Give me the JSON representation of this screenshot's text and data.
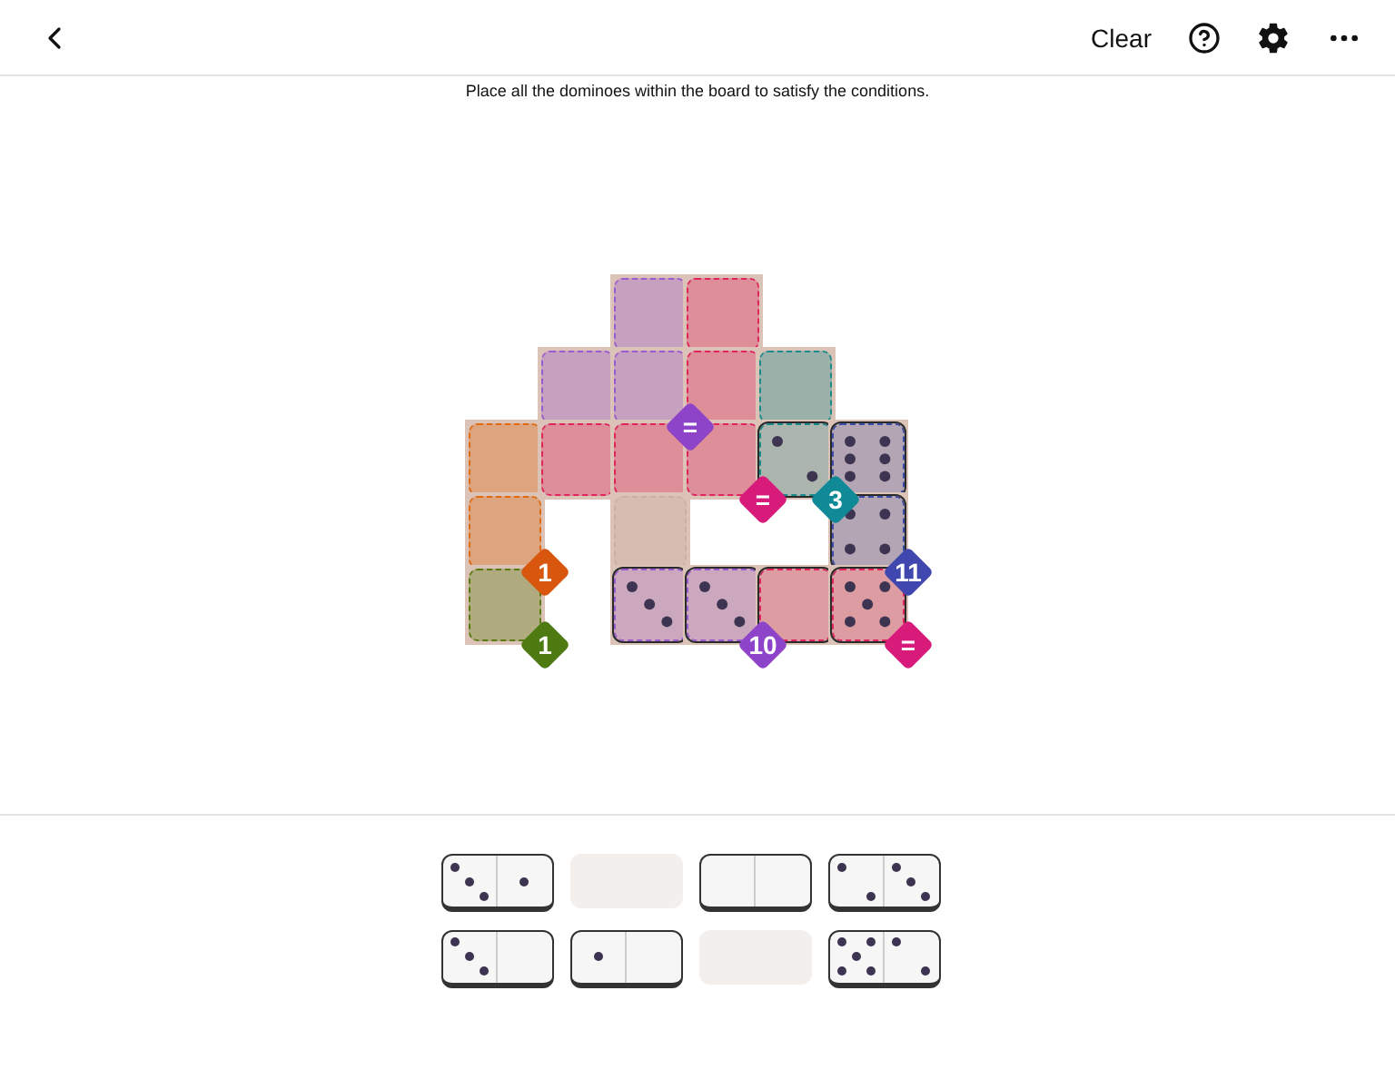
{
  "header": {
    "clear": "Clear"
  },
  "instruction": "Place all the dominoes within the board to satisfy the conditions.",
  "board": {
    "rows": [
      {
        "cells": [
          {
            "kind": "hole"
          },
          {
            "kind": "hole"
          },
          {
            "kind": "cell",
            "color": "#9b59d0"
          },
          {
            "kind": "cell",
            "color": "#e0245e"
          },
          {
            "kind": "hole"
          },
          {
            "kind": "hole"
          }
        ]
      },
      {
        "cells": [
          {
            "kind": "hole"
          },
          {
            "kind": "cell",
            "color": "#9b59d0"
          },
          {
            "kind": "cell",
            "color": "#9b59d0",
            "badge": {
              "label": "=",
              "color": "#8e44c8"
            }
          },
          {
            "kind": "cell",
            "color": "#e0245e"
          },
          {
            "kind": "cell",
            "color": "#1a8a8a"
          },
          {
            "kind": "hole"
          }
        ]
      },
      {
        "cells": [
          {
            "kind": "cell",
            "color": "#e06a10"
          },
          {
            "kind": "cell",
            "color": "#e0245e"
          },
          {
            "kind": "cell",
            "color": "#e0245e"
          },
          {
            "kind": "cell",
            "color": "#e0245e",
            "badge": {
              "label": "=",
              "color": "#d81b7a"
            }
          },
          {
            "kind": "cell",
            "color": "#1a8a8a",
            "face": {
              "kind": "two"
            },
            "badge": {
              "label": "3",
              "color": "#108a96"
            }
          },
          {
            "kind": "cell",
            "color": "#3a4aa8",
            "face": {
              "kind": "six"
            }
          }
        ]
      },
      {
        "cells": [
          {
            "kind": "cell",
            "color": "#e06a10",
            "badge": {
              "label": "1",
              "color": "#d9560e"
            }
          },
          {
            "kind": "hole"
          },
          {
            "kind": "cell",
            "color": "#c8b0a6"
          },
          {
            "kind": "hole"
          },
          {
            "kind": "hole"
          },
          {
            "kind": "cell",
            "color": "#3a4aa8",
            "face": {
              "kind": "four"
            },
            "badge": {
              "label": "11",
              "color": "#4048b0"
            }
          }
        ]
      },
      {
        "cells": [
          {
            "kind": "cell",
            "color": "#5a7a10",
            "badge": {
              "label": "1",
              "color": "#4e7a12"
            }
          },
          {
            "kind": "hole"
          },
          {
            "kind": "cell",
            "color": "#9b59d0",
            "face": {
              "kind": "three"
            }
          },
          {
            "kind": "cell",
            "color": "#9b59d0",
            "face": {
              "kind": "three"
            },
            "badge": {
              "label": "10",
              "color": "#8e44c8"
            }
          },
          {
            "kind": "cell",
            "color": "#e0245e",
            "face": {
              "kind": "blank"
            }
          },
          {
            "kind": "cell",
            "color": "#e0245e",
            "face": {
              "kind": "five"
            },
            "badge": {
              "label": "=",
              "color": "#d81b7a"
            }
          }
        ]
      }
    ]
  },
  "tray": [
    {
      "kind": "domino",
      "halves": [
        {
          "kind": "three"
        },
        {
          "kind": "one"
        }
      ]
    },
    {
      "kind": "empty"
    },
    {
      "kind": "domino",
      "halves": [
        {
          "kind": "blank"
        },
        {
          "kind": "blank"
        }
      ]
    },
    {
      "kind": "domino",
      "halves": [
        {
          "kind": "two"
        },
        {
          "kind": "three"
        }
      ]
    },
    {
      "kind": "domino",
      "halves": [
        {
          "kind": "three"
        },
        {
          "kind": "blank"
        }
      ]
    },
    {
      "kind": "domino",
      "halves": [
        {
          "kind": "one"
        },
        {
          "kind": "blank"
        }
      ]
    },
    {
      "kind": "empty"
    },
    {
      "kind": "domino",
      "halves": [
        {
          "kind": "five"
        },
        {
          "kind": "two"
        }
      ]
    }
  ]
}
